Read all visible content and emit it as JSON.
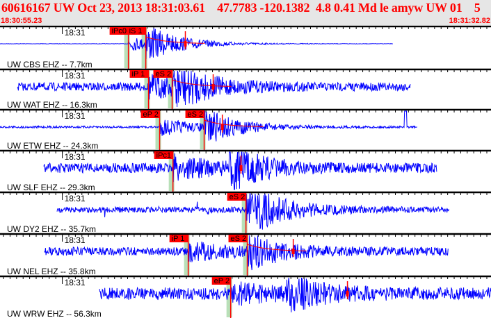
{
  "header": {
    "title": "60616167 UW Oct 23, 2013 18:31:03.61    47.7783 -120.1382  4.8 0.41 Md le amyw UW 01    5",
    "window_start": "18:30:55.23",
    "window_end": "18:31:32.82"
  },
  "time_tick_label": "18:31",
  "colors": {
    "trace": "#0000ff",
    "pick": "#ff0000",
    "pick_window": "#b8e0b8",
    "header_bg": "#e6e6e6",
    "title": "#ff0000"
  },
  "channels": [
    {
      "label": "UW CBS EHZ -- 7.7km",
      "picks": [
        {
          "label": "iPc0",
          "time": "18:31:05.06"
        },
        {
          "label": "iS 1",
          "time": "18:31:06.39"
        }
      ],
      "extra_marks": [
        "18:31:09.42"
      ]
    },
    {
      "label": "UW WAT EHZ -- 16.3km",
      "picks": [
        {
          "label": "iP 1",
          "time": "18:31:06.60"
        },
        {
          "label": "eS 2",
          "time": "18:31:08.41"
        }
      ],
      "extra_marks": [
        "18:31:11.55"
      ]
    },
    {
      "label": "UW ETW EHZ -- 24.3km",
      "picks": [
        {
          "label": "eP 2",
          "time": "18:31:07.45"
        },
        {
          "label": "eS 2",
          "time": "18:31:10.86"
        }
      ],
      "extra_marks": [
        "18:31:12.25"
      ]
    },
    {
      "label": "UW SLF EHZ -- 29.3km",
      "picks": [
        {
          "label": "iPc1",
          "time": "18:31:08.47"
        }
      ],
      "extra_marks": [
        "18:31:13.68"
      ]
    },
    {
      "label": "UW DY2 EHZ -- 35.7km",
      "picks": [
        {
          "label": "eS 2",
          "time": "18:31:14.06"
        }
      ],
      "extra_marks": []
    },
    {
      "label": "UW NEL EHZ -- 35.8km",
      "picks": [
        {
          "label": "iP 1",
          "time": "18:31:09.64"
        },
        {
          "label": "eS 2",
          "time": "18:31:14.16"
        }
      ],
      "extra_marks": [
        "18:31:17.68"
      ]
    },
    {
      "label": "UW WRW EHZ -- 56.3km",
      "picks": [
        {
          "label": "eP 2",
          "time": "18:31:12.89"
        }
      ],
      "extra_marks": [
        "18:31:21.83"
      ]
    }
  ]
}
